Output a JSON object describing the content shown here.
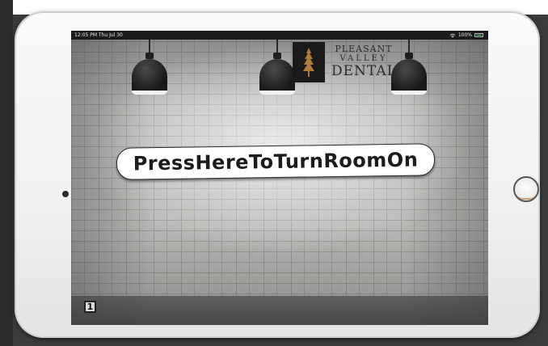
{
  "status_bar": {
    "time_date": "12:05 PM  Thu Jul 30",
    "battery": "100%",
    "icons": [
      "wifi-icon",
      "battery-icon"
    ]
  },
  "logo": {
    "line1": "PLEASANT",
    "line2": "VALLEY",
    "line3": "DENTAL",
    "icon": "tree-icon"
  },
  "main": {
    "turn_on_label": "PressHereToTurnRoomOn"
  },
  "room_badge": {
    "label": "1"
  },
  "colors": {
    "button_fill": "#ffffff",
    "text_dark": "#1c1c1c",
    "battery_green": "#4cd964",
    "logo_background": "#1a1a1a"
  }
}
